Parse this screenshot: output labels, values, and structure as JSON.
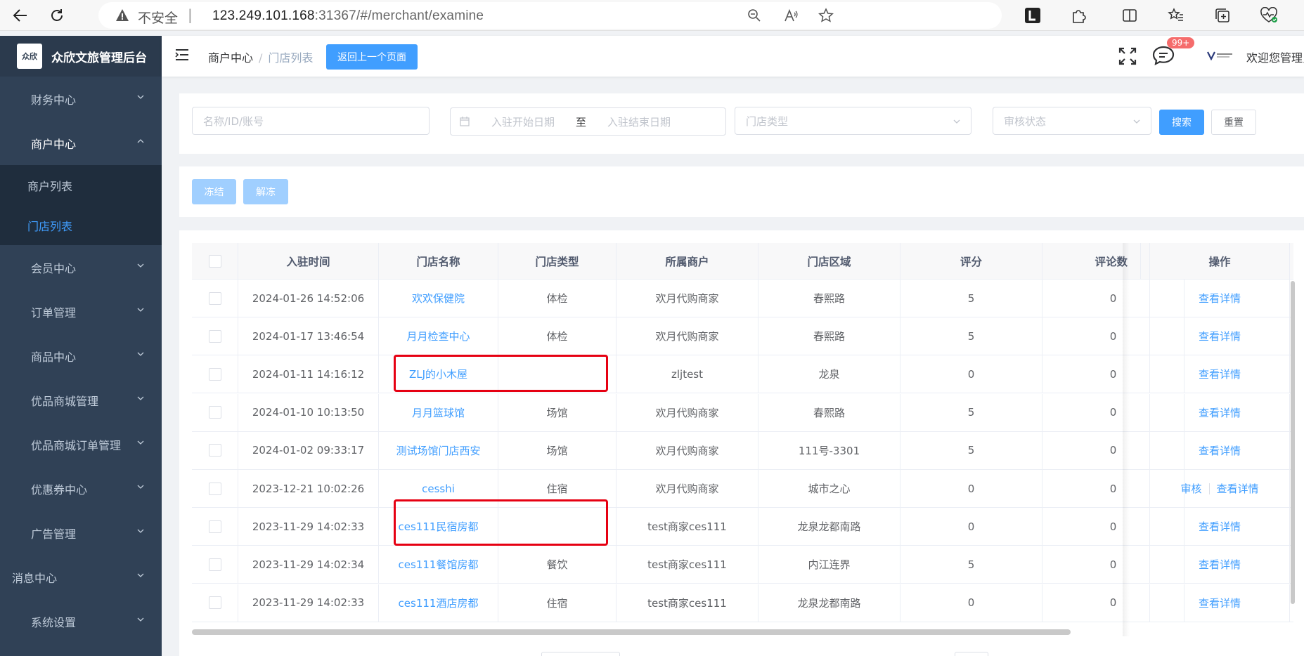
{
  "browser": {
    "security_label": "不安全",
    "url_host": "123.249.101.168",
    "url_rest": ":31367/#/merchant/examine"
  },
  "sidebar": {
    "brand_title": "众欣文旅管理后台",
    "logo_text": "众欣",
    "items": [
      {
        "label": "财务中心"
      },
      {
        "label": "商户中心"
      },
      {
        "label": "商户列表"
      },
      {
        "label": "门店列表"
      },
      {
        "label": "会员中心"
      },
      {
        "label": "订单管理"
      },
      {
        "label": "商品中心"
      },
      {
        "label": "优品商城管理"
      },
      {
        "label": "优品商城订单管理"
      },
      {
        "label": "优惠券中心"
      },
      {
        "label": "广告管理"
      },
      {
        "label": "消息中心"
      },
      {
        "label": "系统设置"
      }
    ]
  },
  "navbar": {
    "breadcrumb_1": "商户中心",
    "breadcrumb_2": "门店列表",
    "back_button": "返回上一个页面",
    "badge": "99+",
    "welcome": "欢迎您管理员"
  },
  "filters": {
    "name_placeholder": "名称/ID/账号",
    "start_date_placeholder": "入驻开始日期",
    "date_separator": "至",
    "end_date_placeholder": "入驻结束日期",
    "store_type_placeholder": "门店类型",
    "audit_status_placeholder": "审核状态",
    "search_button": "搜索",
    "reset_button": "重置"
  },
  "actions": {
    "freeze_button": "冻结",
    "unfreeze_button": "解冻"
  },
  "table": {
    "headers": [
      "入驻时间",
      "门店名称",
      "门店类型",
      "所属商户",
      "门店区域",
      "评分",
      "评论数",
      "操作"
    ],
    "rows": [
      {
        "time": "2024-01-26 14:52:06",
        "name": "欢欢保健院",
        "type": "体检",
        "merchant": "欢月代购商家",
        "area": "春熙路",
        "score": "5",
        "comments": "0",
        "op1": "查看详情",
        "op2": ""
      },
      {
        "time": "2024-01-17 13:46:54",
        "name": "月月检查中心",
        "type": "体检",
        "merchant": "欢月代购商家",
        "area": "春熙路",
        "score": "5",
        "comments": "0",
        "op1": "查看详情",
        "op2": ""
      },
      {
        "time": "2024-01-11 14:16:12",
        "name": "ZLJ的小木屋",
        "type": "",
        "merchant": "zljtest",
        "area": "龙泉",
        "score": "0",
        "comments": "0",
        "op1": "查看详情",
        "op2": ""
      },
      {
        "time": "2024-01-10 10:13:50",
        "name": "月月篮球馆",
        "type": "场馆",
        "merchant": "欢月代购商家",
        "area": "春熙路",
        "score": "5",
        "comments": "0",
        "op1": "查看详情",
        "op2": ""
      },
      {
        "time": "2024-01-02 09:33:17",
        "name": "测试场馆门店西安",
        "type": "场馆",
        "merchant": "欢月代购商家",
        "area": "111号-3301",
        "score": "5",
        "comments": "0",
        "op1": "查看详情",
        "op2": ""
      },
      {
        "time": "2023-12-21 10:02:26",
        "name": "cesshi",
        "type": "住宿",
        "merchant": "欢月代购商家",
        "area": "城市之心",
        "score": "0",
        "comments": "0",
        "op1": "审核",
        "op2": "查看详情"
      },
      {
        "time": "2023-11-29 14:02:33",
        "name": "ces111民宿房都",
        "type": "",
        "merchant": "test商家ces111",
        "area": "龙泉龙都南路",
        "score": "0",
        "comments": "0",
        "op1": "查看详情",
        "op2": ""
      },
      {
        "time": "2023-11-29 14:02:34",
        "name": "ces111餐馆房都",
        "type": "餐饮",
        "merchant": "test商家ces111",
        "area": "内江连界",
        "score": "5",
        "comments": "0",
        "op1": "查看详情",
        "op2": ""
      },
      {
        "time": "2023-11-29 14:02:33",
        "name": "ces111酒店房都",
        "type": "住宿",
        "merchant": "test商家ces111",
        "area": "龙泉龙都南路",
        "score": "0",
        "comments": "0",
        "op1": "查看详情",
        "op2": ""
      }
    ]
  },
  "colors": {
    "sidebar_bg": "#304156",
    "accent": "#409eff",
    "highlight_box": "#e60012"
  }
}
